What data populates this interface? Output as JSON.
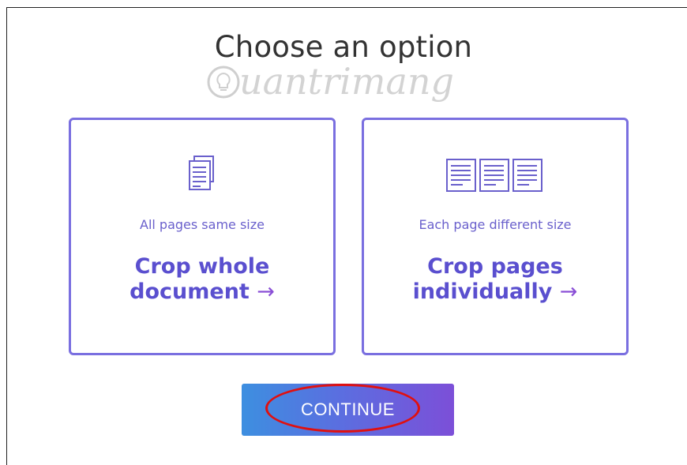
{
  "page": {
    "title": "Choose an option",
    "watermark": "uantrimang"
  },
  "options": [
    {
      "subtitle": "All pages same size",
      "action_line1": "Crop whole",
      "action_line2": "document",
      "arrow": "→",
      "icon": "single-document-icon"
    },
    {
      "subtitle": "Each page different size",
      "action_line1": "Crop pages",
      "action_line2": "individually",
      "arrow": "→",
      "icon": "multiple-documents-icon"
    }
  ],
  "continue_button": {
    "label": "CONTINUE",
    "highlighted": true
  },
  "colors": {
    "accent": "#5a4fcf",
    "card_border": "#7a6fe0",
    "button_gradient_start": "#3d8fe0",
    "button_gradient_end": "#7c4fd8",
    "highlight": "#e01010"
  }
}
